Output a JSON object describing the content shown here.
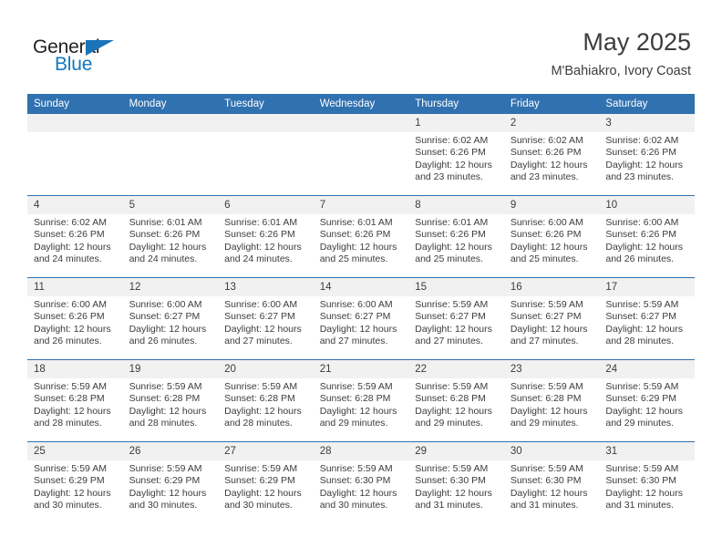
{
  "brand": {
    "name_part1": "General",
    "name_part2": "Blue",
    "flag_icon": "triangle-flag-icon",
    "accent_color": "#1974b8"
  },
  "header": {
    "month_title": "May 2025",
    "location": "M'Bahiakro, Ivory Coast"
  },
  "calendar": {
    "header_color": "#3071b0",
    "daynum_background": "#f1f1f1",
    "weekday_headers": [
      "Sunday",
      "Monday",
      "Tuesday",
      "Wednesday",
      "Thursday",
      "Friday",
      "Saturday"
    ],
    "weeks": [
      [
        {
          "day": "",
          "sunrise": "",
          "sunset": "",
          "daylight1": "",
          "daylight2": ""
        },
        {
          "day": "",
          "sunrise": "",
          "sunset": "",
          "daylight1": "",
          "daylight2": ""
        },
        {
          "day": "",
          "sunrise": "",
          "sunset": "",
          "daylight1": "",
          "daylight2": ""
        },
        {
          "day": "",
          "sunrise": "",
          "sunset": "",
          "daylight1": "",
          "daylight2": ""
        },
        {
          "day": "1",
          "sunrise": "Sunrise: 6:02 AM",
          "sunset": "Sunset: 6:26 PM",
          "daylight1": "Daylight: 12 hours",
          "daylight2": "and 23 minutes."
        },
        {
          "day": "2",
          "sunrise": "Sunrise: 6:02 AM",
          "sunset": "Sunset: 6:26 PM",
          "daylight1": "Daylight: 12 hours",
          "daylight2": "and 23 minutes."
        },
        {
          "day": "3",
          "sunrise": "Sunrise: 6:02 AM",
          "sunset": "Sunset: 6:26 PM",
          "daylight1": "Daylight: 12 hours",
          "daylight2": "and 23 minutes."
        }
      ],
      [
        {
          "day": "4",
          "sunrise": "Sunrise: 6:02 AM",
          "sunset": "Sunset: 6:26 PM",
          "daylight1": "Daylight: 12 hours",
          "daylight2": "and 24 minutes."
        },
        {
          "day": "5",
          "sunrise": "Sunrise: 6:01 AM",
          "sunset": "Sunset: 6:26 PM",
          "daylight1": "Daylight: 12 hours",
          "daylight2": "and 24 minutes."
        },
        {
          "day": "6",
          "sunrise": "Sunrise: 6:01 AM",
          "sunset": "Sunset: 6:26 PM",
          "daylight1": "Daylight: 12 hours",
          "daylight2": "and 24 minutes."
        },
        {
          "day": "7",
          "sunrise": "Sunrise: 6:01 AM",
          "sunset": "Sunset: 6:26 PM",
          "daylight1": "Daylight: 12 hours",
          "daylight2": "and 25 minutes."
        },
        {
          "day": "8",
          "sunrise": "Sunrise: 6:01 AM",
          "sunset": "Sunset: 6:26 PM",
          "daylight1": "Daylight: 12 hours",
          "daylight2": "and 25 minutes."
        },
        {
          "day": "9",
          "sunrise": "Sunrise: 6:00 AM",
          "sunset": "Sunset: 6:26 PM",
          "daylight1": "Daylight: 12 hours",
          "daylight2": "and 25 minutes."
        },
        {
          "day": "10",
          "sunrise": "Sunrise: 6:00 AM",
          "sunset": "Sunset: 6:26 PM",
          "daylight1": "Daylight: 12 hours",
          "daylight2": "and 26 minutes."
        }
      ],
      [
        {
          "day": "11",
          "sunrise": "Sunrise: 6:00 AM",
          "sunset": "Sunset: 6:26 PM",
          "daylight1": "Daylight: 12 hours",
          "daylight2": "and 26 minutes."
        },
        {
          "day": "12",
          "sunrise": "Sunrise: 6:00 AM",
          "sunset": "Sunset: 6:27 PM",
          "daylight1": "Daylight: 12 hours",
          "daylight2": "and 26 minutes."
        },
        {
          "day": "13",
          "sunrise": "Sunrise: 6:00 AM",
          "sunset": "Sunset: 6:27 PM",
          "daylight1": "Daylight: 12 hours",
          "daylight2": "and 27 minutes."
        },
        {
          "day": "14",
          "sunrise": "Sunrise: 6:00 AM",
          "sunset": "Sunset: 6:27 PM",
          "daylight1": "Daylight: 12 hours",
          "daylight2": "and 27 minutes."
        },
        {
          "day": "15",
          "sunrise": "Sunrise: 5:59 AM",
          "sunset": "Sunset: 6:27 PM",
          "daylight1": "Daylight: 12 hours",
          "daylight2": "and 27 minutes."
        },
        {
          "day": "16",
          "sunrise": "Sunrise: 5:59 AM",
          "sunset": "Sunset: 6:27 PM",
          "daylight1": "Daylight: 12 hours",
          "daylight2": "and 27 minutes."
        },
        {
          "day": "17",
          "sunrise": "Sunrise: 5:59 AM",
          "sunset": "Sunset: 6:27 PM",
          "daylight1": "Daylight: 12 hours",
          "daylight2": "and 28 minutes."
        }
      ],
      [
        {
          "day": "18",
          "sunrise": "Sunrise: 5:59 AM",
          "sunset": "Sunset: 6:28 PM",
          "daylight1": "Daylight: 12 hours",
          "daylight2": "and 28 minutes."
        },
        {
          "day": "19",
          "sunrise": "Sunrise: 5:59 AM",
          "sunset": "Sunset: 6:28 PM",
          "daylight1": "Daylight: 12 hours",
          "daylight2": "and 28 minutes."
        },
        {
          "day": "20",
          "sunrise": "Sunrise: 5:59 AM",
          "sunset": "Sunset: 6:28 PM",
          "daylight1": "Daylight: 12 hours",
          "daylight2": "and 28 minutes."
        },
        {
          "day": "21",
          "sunrise": "Sunrise: 5:59 AM",
          "sunset": "Sunset: 6:28 PM",
          "daylight1": "Daylight: 12 hours",
          "daylight2": "and 29 minutes."
        },
        {
          "day": "22",
          "sunrise": "Sunrise: 5:59 AM",
          "sunset": "Sunset: 6:28 PM",
          "daylight1": "Daylight: 12 hours",
          "daylight2": "and 29 minutes."
        },
        {
          "day": "23",
          "sunrise": "Sunrise: 5:59 AM",
          "sunset": "Sunset: 6:28 PM",
          "daylight1": "Daylight: 12 hours",
          "daylight2": "and 29 minutes."
        },
        {
          "day": "24",
          "sunrise": "Sunrise: 5:59 AM",
          "sunset": "Sunset: 6:29 PM",
          "daylight1": "Daylight: 12 hours",
          "daylight2": "and 29 minutes."
        }
      ],
      [
        {
          "day": "25",
          "sunrise": "Sunrise: 5:59 AM",
          "sunset": "Sunset: 6:29 PM",
          "daylight1": "Daylight: 12 hours",
          "daylight2": "and 30 minutes."
        },
        {
          "day": "26",
          "sunrise": "Sunrise: 5:59 AM",
          "sunset": "Sunset: 6:29 PM",
          "daylight1": "Daylight: 12 hours",
          "daylight2": "and 30 minutes."
        },
        {
          "day": "27",
          "sunrise": "Sunrise: 5:59 AM",
          "sunset": "Sunset: 6:29 PM",
          "daylight1": "Daylight: 12 hours",
          "daylight2": "and 30 minutes."
        },
        {
          "day": "28",
          "sunrise": "Sunrise: 5:59 AM",
          "sunset": "Sunset: 6:30 PM",
          "daylight1": "Daylight: 12 hours",
          "daylight2": "and 30 minutes."
        },
        {
          "day": "29",
          "sunrise": "Sunrise: 5:59 AM",
          "sunset": "Sunset: 6:30 PM",
          "daylight1": "Daylight: 12 hours",
          "daylight2": "and 31 minutes."
        },
        {
          "day": "30",
          "sunrise": "Sunrise: 5:59 AM",
          "sunset": "Sunset: 6:30 PM",
          "daylight1": "Daylight: 12 hours",
          "daylight2": "and 31 minutes."
        },
        {
          "day": "31",
          "sunrise": "Sunrise: 5:59 AM",
          "sunset": "Sunset: 6:30 PM",
          "daylight1": "Daylight: 12 hours",
          "daylight2": "and 31 minutes."
        }
      ]
    ]
  }
}
